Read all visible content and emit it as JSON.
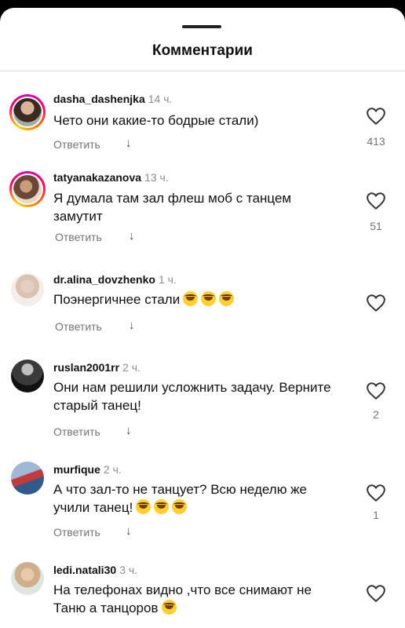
{
  "header": {
    "title": "Комментарии"
  },
  "reply_label": "Ответить",
  "comments": [
    {
      "user": "dasha_dashenjka",
      "time": "14 ч.",
      "text": "Чето они какие-то бодрые стали)",
      "likes": "413"
    },
    {
      "user": "tatyanakazanova",
      "time": "13 ч.",
      "text": "Я думала там зал флеш моб с танцем замутит",
      "likes": "51"
    },
    {
      "user": "dr.alina_dovzhenko",
      "time": "1 ч.",
      "text": "Поэнергичнее стали",
      "likes": ""
    },
    {
      "user": "ruslan2001rr",
      "time": "2 ч.",
      "text": "Они нам решили усложнить задачу. Верните старый танец!",
      "likes": "2"
    },
    {
      "user": "murfique",
      "time": "2 ч.",
      "text": "А что зал-то не танцует? Всю неделю же учили танец!",
      "likes": "1"
    },
    {
      "user": "ledi.natali30",
      "time": "3 ч.",
      "text": "На телефонах видно ,что все снимают не Таню а танцоров",
      "likes": ""
    }
  ],
  "colors": {
    "story_ring": "#ff0069",
    "text": "#111111",
    "muted": "#737373"
  }
}
